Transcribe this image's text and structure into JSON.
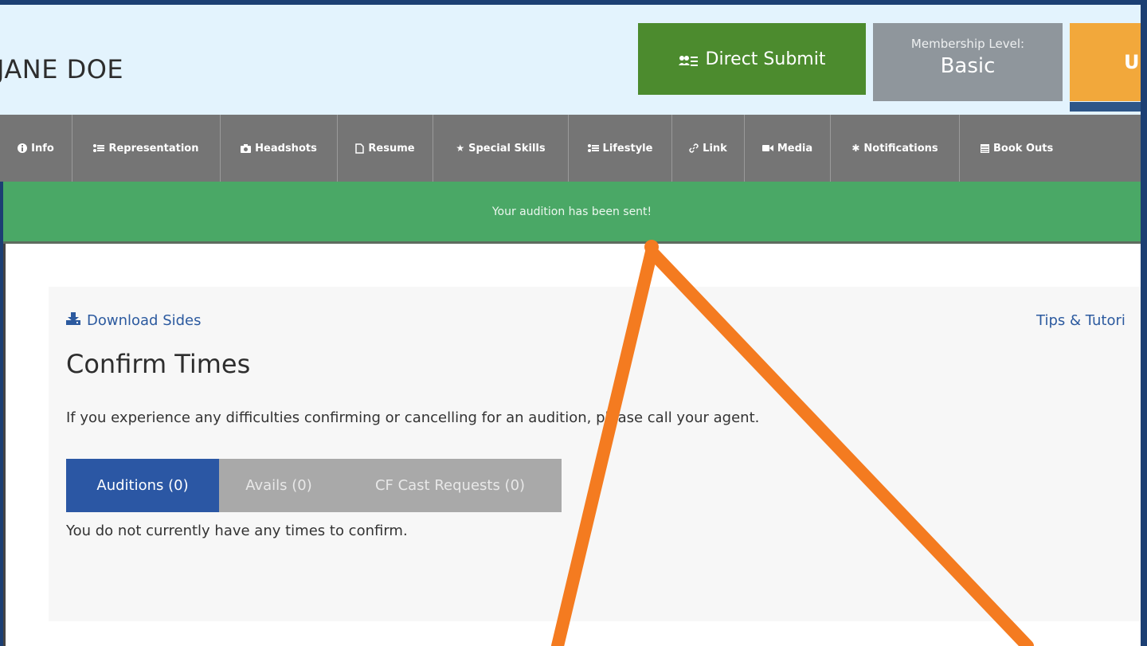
{
  "header": {
    "user_name": "JANE DOE",
    "direct_submit_label": "Direct Submit",
    "membership_label": "Membership Level:",
    "membership_level": "Basic",
    "upgrade_label": "Up"
  },
  "nav": {
    "items": [
      {
        "label": "Info",
        "icon": "info-icon"
      },
      {
        "label": "Representation",
        "icon": "list-icon"
      },
      {
        "label": "Headshots",
        "icon": "camera-icon"
      },
      {
        "label": "Resume",
        "icon": "document-icon"
      },
      {
        "label": "Special Skills",
        "icon": "star-icon"
      },
      {
        "label": "Lifestyle",
        "icon": "list-icon"
      },
      {
        "label": "Link",
        "icon": "link-icon"
      },
      {
        "label": "Media",
        "icon": "video-icon"
      },
      {
        "label": "Notifications",
        "icon": "asterisk-icon"
      },
      {
        "label": "Book Outs",
        "icon": "calendar-icon"
      }
    ]
  },
  "alert": {
    "message": "Your audition has been sent!"
  },
  "main": {
    "download_sides_label": "Download Sides",
    "tips_label": "Tips & Tutori",
    "title": "Confirm Times",
    "description": "If you experience any difficulties confirming or cancelling for an audition, please call your agent.",
    "tabs": [
      {
        "label": "Auditions (0)",
        "active": true
      },
      {
        "label": "Avails (0)",
        "active": false
      },
      {
        "label": "CF Cast Requests (0)",
        "active": false
      }
    ],
    "empty_message": "You do not currently have any times to confirm."
  },
  "colors": {
    "frame": "#1c3f73",
    "header_bg": "#e3f3fd",
    "direct_submit": "#4c8b2e",
    "membership": "#8f969c",
    "upgrade": "#f2a83b",
    "nav_bg": "#757575",
    "alert_bg": "#4aa866",
    "tab_active": "#2b57a4",
    "tab_inactive": "#a9a9a9",
    "annotation_arrow": "#f47b20"
  }
}
